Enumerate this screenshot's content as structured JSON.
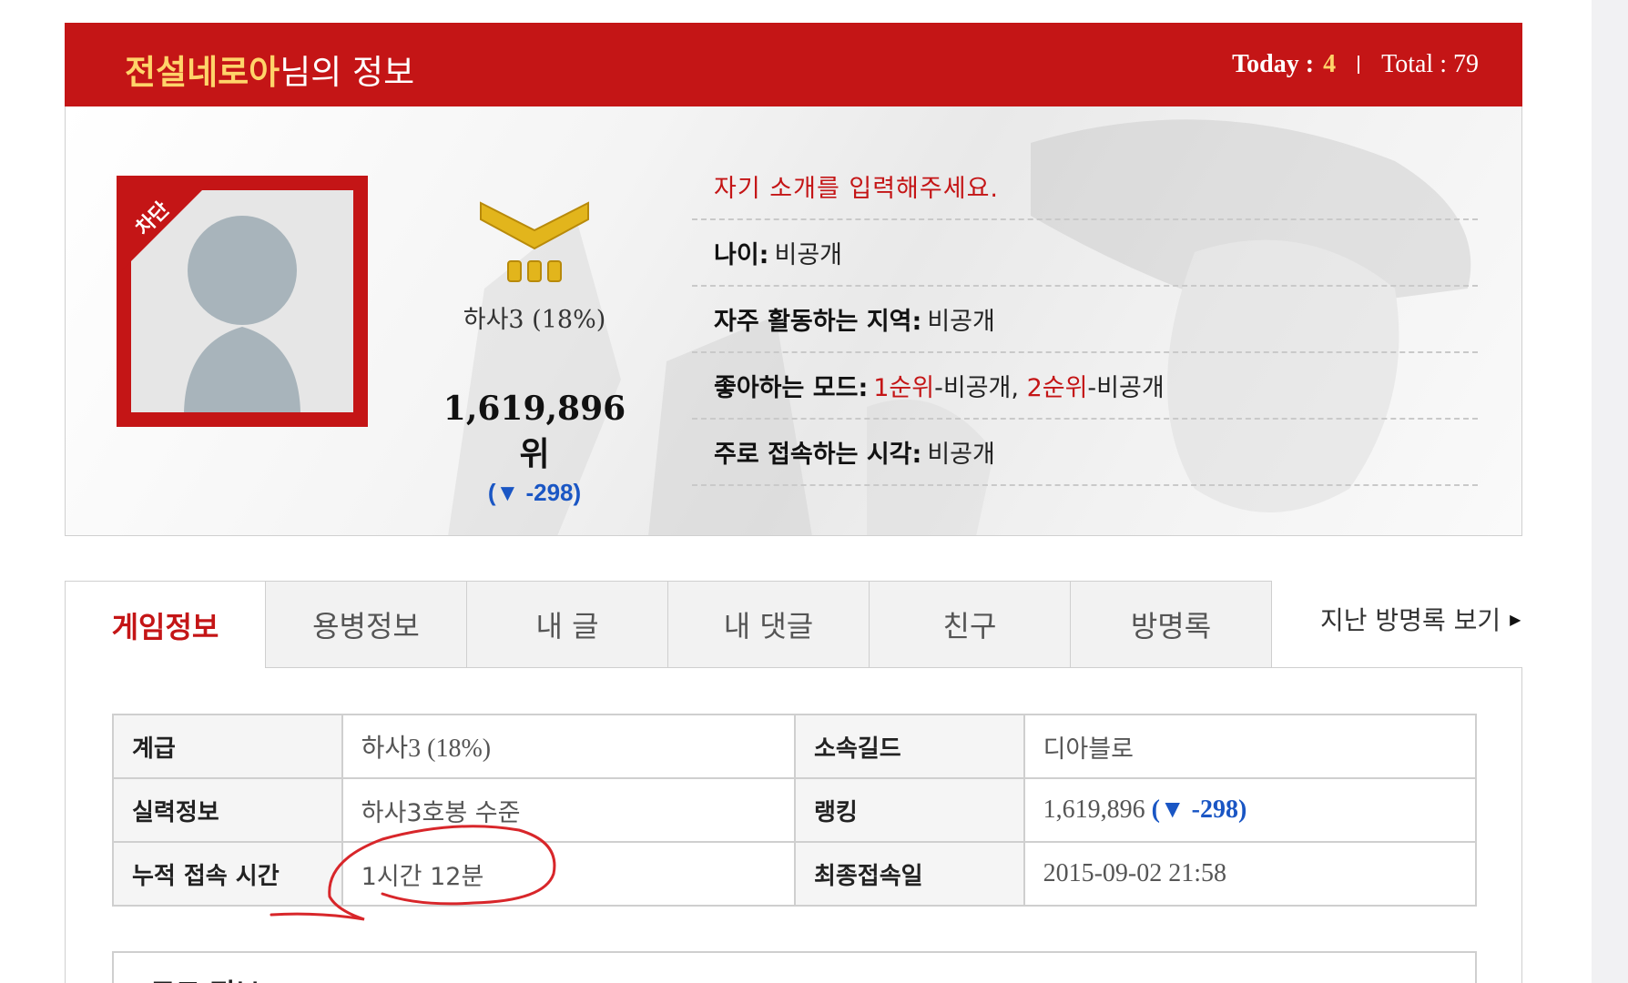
{
  "header": {
    "nickname": "전설네로아",
    "title_suffix": "님의 정보",
    "today_label": "Today :",
    "today_value": "4",
    "total_label": "Total : 79"
  },
  "profile": {
    "badge_text": "차단",
    "rank_title": "하사3 (18%)",
    "ranking": "1,619,896위",
    "ranking_change": "(▼ -298)",
    "intro": "자기 소개를 입력해주세요.",
    "age_label": "나이:",
    "age_value": "비공개",
    "region_label": "자주 활동하는 지역:",
    "region_value": "비공개",
    "mode_label": "좋아하는 모드:",
    "mode_rank1": "1순위",
    "mode_value1": "-비공개,",
    "mode_rank2": "2순위",
    "mode_value2": "-비공개",
    "time_label": "주로 접속하는 시각:",
    "time_value": "비공개"
  },
  "tabs": [
    {
      "label": "게임정보"
    },
    {
      "label": "용병정보"
    },
    {
      "label": "내 글"
    },
    {
      "label": "내 댓글"
    },
    {
      "label": "친구"
    },
    {
      "label": "방명록"
    }
  ],
  "past_guestbook_link": "지난 방명록 보기",
  "game_info": {
    "rank_label": "계급",
    "rank_value": "하사3 (18%)",
    "guild_label": "소속길드",
    "guild_value": "디아블로",
    "skill_label": "실력정보",
    "skill_value": "하사3호봉 수준",
    "ranking_label": "랭킹",
    "ranking_value": "1,619,896",
    "ranking_change": "(▼ -298)",
    "playtime_label": "누적 접속 시간",
    "playtime_value": "1시간 12분",
    "lastlogin_label": "최종접속일",
    "lastlogin_value": "2015-09-02 21:58"
  },
  "bottom_section": {
    "label": "모드 정보"
  },
  "colors": {
    "brand_red": "#c41516",
    "accent_yellow": "#ffd46a",
    "rank_blue": "#1a56c4"
  }
}
